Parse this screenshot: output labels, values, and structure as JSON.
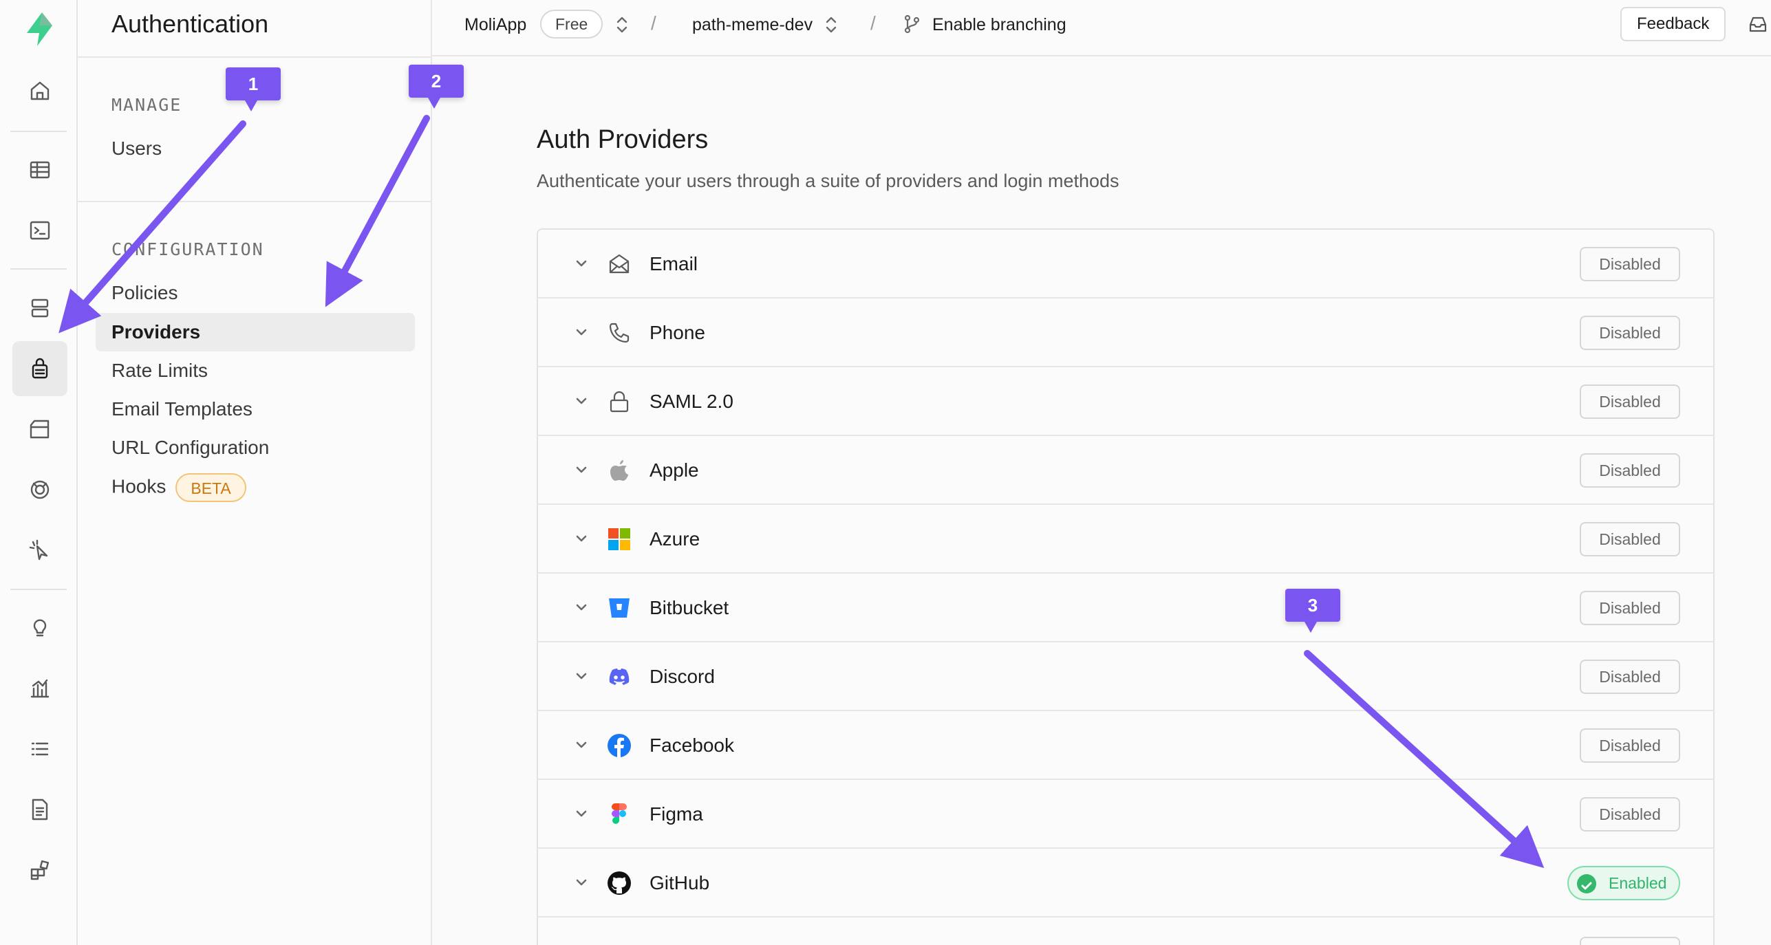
{
  "rail": {
    "items": [
      {
        "icon": "home-icon"
      },
      {
        "icon": "table-editor-icon"
      },
      {
        "icon": "sql-editor-icon"
      },
      {
        "icon": "database-icon"
      },
      {
        "icon": "authentication-icon",
        "active": true
      },
      {
        "icon": "storage-icon"
      },
      {
        "icon": "realtime-icon"
      },
      {
        "icon": "edge-functions-icon"
      },
      {
        "icon": "advisors-icon"
      },
      {
        "icon": "reports-icon"
      },
      {
        "icon": "logs-icon"
      },
      {
        "icon": "api-docs-icon"
      },
      {
        "icon": "integrations-icon"
      }
    ]
  },
  "menu": {
    "title": "Authentication",
    "manage_heading": "MANAGE",
    "users": "Users",
    "configuration_heading": "CONFIGURATION",
    "policies": "Policies",
    "providers": "Providers",
    "rate_limits": "Rate Limits",
    "email_templates": "Email Templates",
    "url_configuration": "URL Configuration",
    "hooks": "Hooks",
    "hooks_badge": "BETA"
  },
  "topbar": {
    "org": "MoliApp",
    "plan": "Free",
    "project": "path-meme-dev",
    "branching": "Enable branching",
    "feedback": "Feedback"
  },
  "page": {
    "title": "Auth Providers",
    "subtitle": "Authenticate your users through a suite of providers and login methods"
  },
  "providers": [
    {
      "name": "Email",
      "status": "Disabled",
      "icon": "email-icon"
    },
    {
      "name": "Phone",
      "status": "Disabled",
      "icon": "phone-icon"
    },
    {
      "name": "SAML 2.0",
      "status": "Disabled",
      "icon": "lock-icon"
    },
    {
      "name": "Apple",
      "status": "Disabled",
      "icon": "apple-icon"
    },
    {
      "name": "Azure",
      "status": "Disabled",
      "icon": "azure-icon"
    },
    {
      "name": "Bitbucket",
      "status": "Disabled",
      "icon": "bitbucket-icon"
    },
    {
      "name": "Discord",
      "status": "Disabled",
      "icon": "discord-icon"
    },
    {
      "name": "Facebook",
      "status": "Disabled",
      "icon": "facebook-icon"
    },
    {
      "name": "Figma",
      "status": "Disabled",
      "icon": "figma-icon"
    },
    {
      "name": "GitHub",
      "status": "Enabled",
      "icon": "github-icon"
    }
  ],
  "annotations": {
    "callout_1": "1",
    "callout_2": "2",
    "callout_3": "3",
    "color": "#7b55f0"
  },
  "colors": {
    "brand": "#3ecf8e",
    "enabled": "#2fb46a"
  }
}
